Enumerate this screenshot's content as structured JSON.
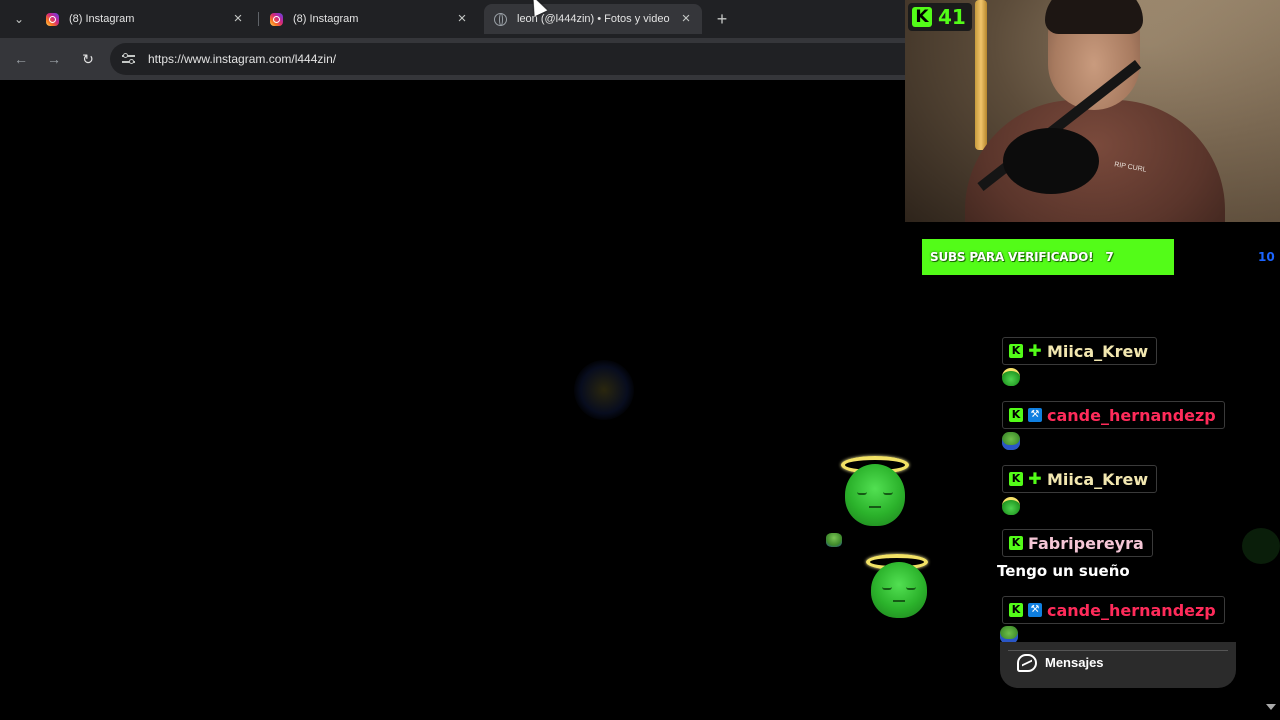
{
  "browser": {
    "tabs": [
      {
        "title": "(8) Instagram",
        "favicon": "instagram-icon",
        "active": false
      },
      {
        "title": "(8) Instagram",
        "favicon": "instagram-icon",
        "active": false
      },
      {
        "title": "leon (@l444zin) • Fotos y video",
        "favicon": "globe-icon",
        "active": true
      }
    ],
    "close_glyph": "×",
    "new_tab_glyph": "+",
    "tab_list_glyph": "⌄",
    "back_glyph": "←",
    "forward_glyph": "→",
    "reload_glyph": "↻",
    "url": "https://www.instagram.com/l444zin/"
  },
  "stream": {
    "viewer_count": "41",
    "kick_glyph": "K",
    "webcam_logo_text": "RIP CURL",
    "goal": {
      "label": "SUBS PARA VERIFICADO!",
      "current": "7",
      "target": "10",
      "progress_fraction": 0.7
    },
    "colors": {
      "kick_green": "#53fc18",
      "mod_blue": "#0f7fe0",
      "goal_target": "#1b64ff"
    },
    "chat": [
      {
        "username": "Miica_Krew",
        "color": "#f2e7b0",
        "badges": [
          "kick-badge",
          "plus-badge"
        ],
        "emote": "green-halo-emote"
      },
      {
        "username": "cande_hernandezp",
        "color": "#ff2b5a",
        "badges": [
          "kick-badge",
          "moderator-badge"
        ],
        "emote": "pepe-emote"
      },
      {
        "username": "Miica_Krew",
        "color": "#f2e7b0",
        "badges": [
          "kick-badge",
          "plus-badge"
        ],
        "emote": "green-halo-emote"
      },
      {
        "username": "Fabripereyra",
        "color": "#f5c6d6",
        "badges": [
          "kick-badge"
        ],
        "message": "Tengo un sueño"
      },
      {
        "username": "cande_hernandezp",
        "color": "#ff2b5a",
        "badges": [
          "kick-badge",
          "moderator-badge"
        ],
        "emote": "pepe-emote"
      }
    ]
  },
  "messenger": {
    "label": "Mensajes"
  }
}
